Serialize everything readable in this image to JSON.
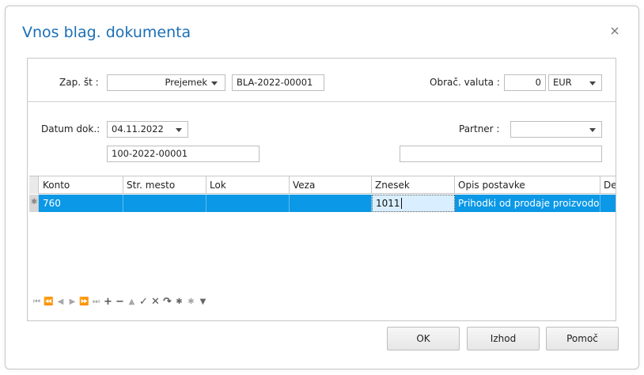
{
  "dialog": {
    "title": "Vnos blag. dokumenta",
    "close_icon": "close-icon"
  },
  "header": {
    "zap_st_label": "Zap. št :",
    "zap_st_select": "Prejemek",
    "zap_st_number": "BLA-2022-00001",
    "obrac_valuta_label": "Obrač. valuta :",
    "obrac_valuta_amount": "0",
    "obrac_valuta_currency": "EUR",
    "datum_dok_label": "Datum dok.:",
    "datum_dok_value": "04.11.2022",
    "doc_number": "100-2022-00001",
    "partner_label": "Partner :",
    "partner_value": "",
    "partner_extra": ""
  },
  "grid": {
    "columns": [
      "Konto",
      "Str. mesto",
      "Lok",
      "Veza",
      "Znesek",
      "Opis postavke",
      "De"
    ],
    "rows": [
      {
        "indicator": "✱",
        "konto": "760",
        "str_mesto": "",
        "lok": "",
        "veza": "",
        "znesek": "1011",
        "opis_postavke": "Prihodki od prodaje proizvodo",
        "de": ""
      }
    ],
    "row_selected_color": "#0b98e6"
  },
  "pager_icons": [
    "first-page-icon",
    "prev-page-icon",
    "prev-record-icon",
    "next-record-icon",
    "next-page-icon",
    "last-page-icon",
    "add-icon",
    "remove-icon",
    "up-icon",
    "confirm-icon",
    "cancel-icon",
    "refresh-icon",
    "asterisk-icon",
    "asterisk-new-icon",
    "filter-icon"
  ],
  "buttons": {
    "ok": "OK",
    "izhod": "Izhod",
    "pomoc": "Pomoč"
  },
  "colors": {
    "title": "#1b6fb6",
    "selection": "#0b98e6"
  }
}
